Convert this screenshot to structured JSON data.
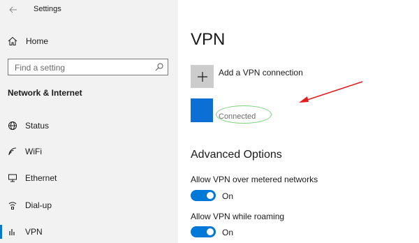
{
  "window": {
    "title": "Settings"
  },
  "sidebar": {
    "home_label": "Home",
    "search": {
      "placeholder": "Find a setting"
    },
    "section_title": "Network & Internet",
    "items": [
      {
        "label": "Status",
        "icon": "globe-icon",
        "selected": false
      },
      {
        "label": "WiFi",
        "icon": "wifi-icon",
        "selected": false
      },
      {
        "label": "Ethernet",
        "icon": "ethernet-icon",
        "selected": false
      },
      {
        "label": "Dial-up",
        "icon": "dialup-icon",
        "selected": false
      },
      {
        "label": "VPN",
        "icon": "vpn-icon",
        "selected": true
      }
    ]
  },
  "main": {
    "title": "VPN",
    "add_vpn_label": "Add a VPN connection",
    "connection": {
      "status": "Connected"
    },
    "advanced": {
      "title": "Advanced Options",
      "options": [
        {
          "label": "Allow VPN over metered networks",
          "state": "On",
          "enabled": true
        },
        {
          "label": "Allow VPN while roaming",
          "state": "On",
          "enabled": true
        }
      ]
    }
  },
  "colors": {
    "accent": "#0078d7",
    "annotation_arrow": "#e02020",
    "annotation_ellipse": "#7bd17b",
    "connection_tile": "#0b6fd6"
  }
}
